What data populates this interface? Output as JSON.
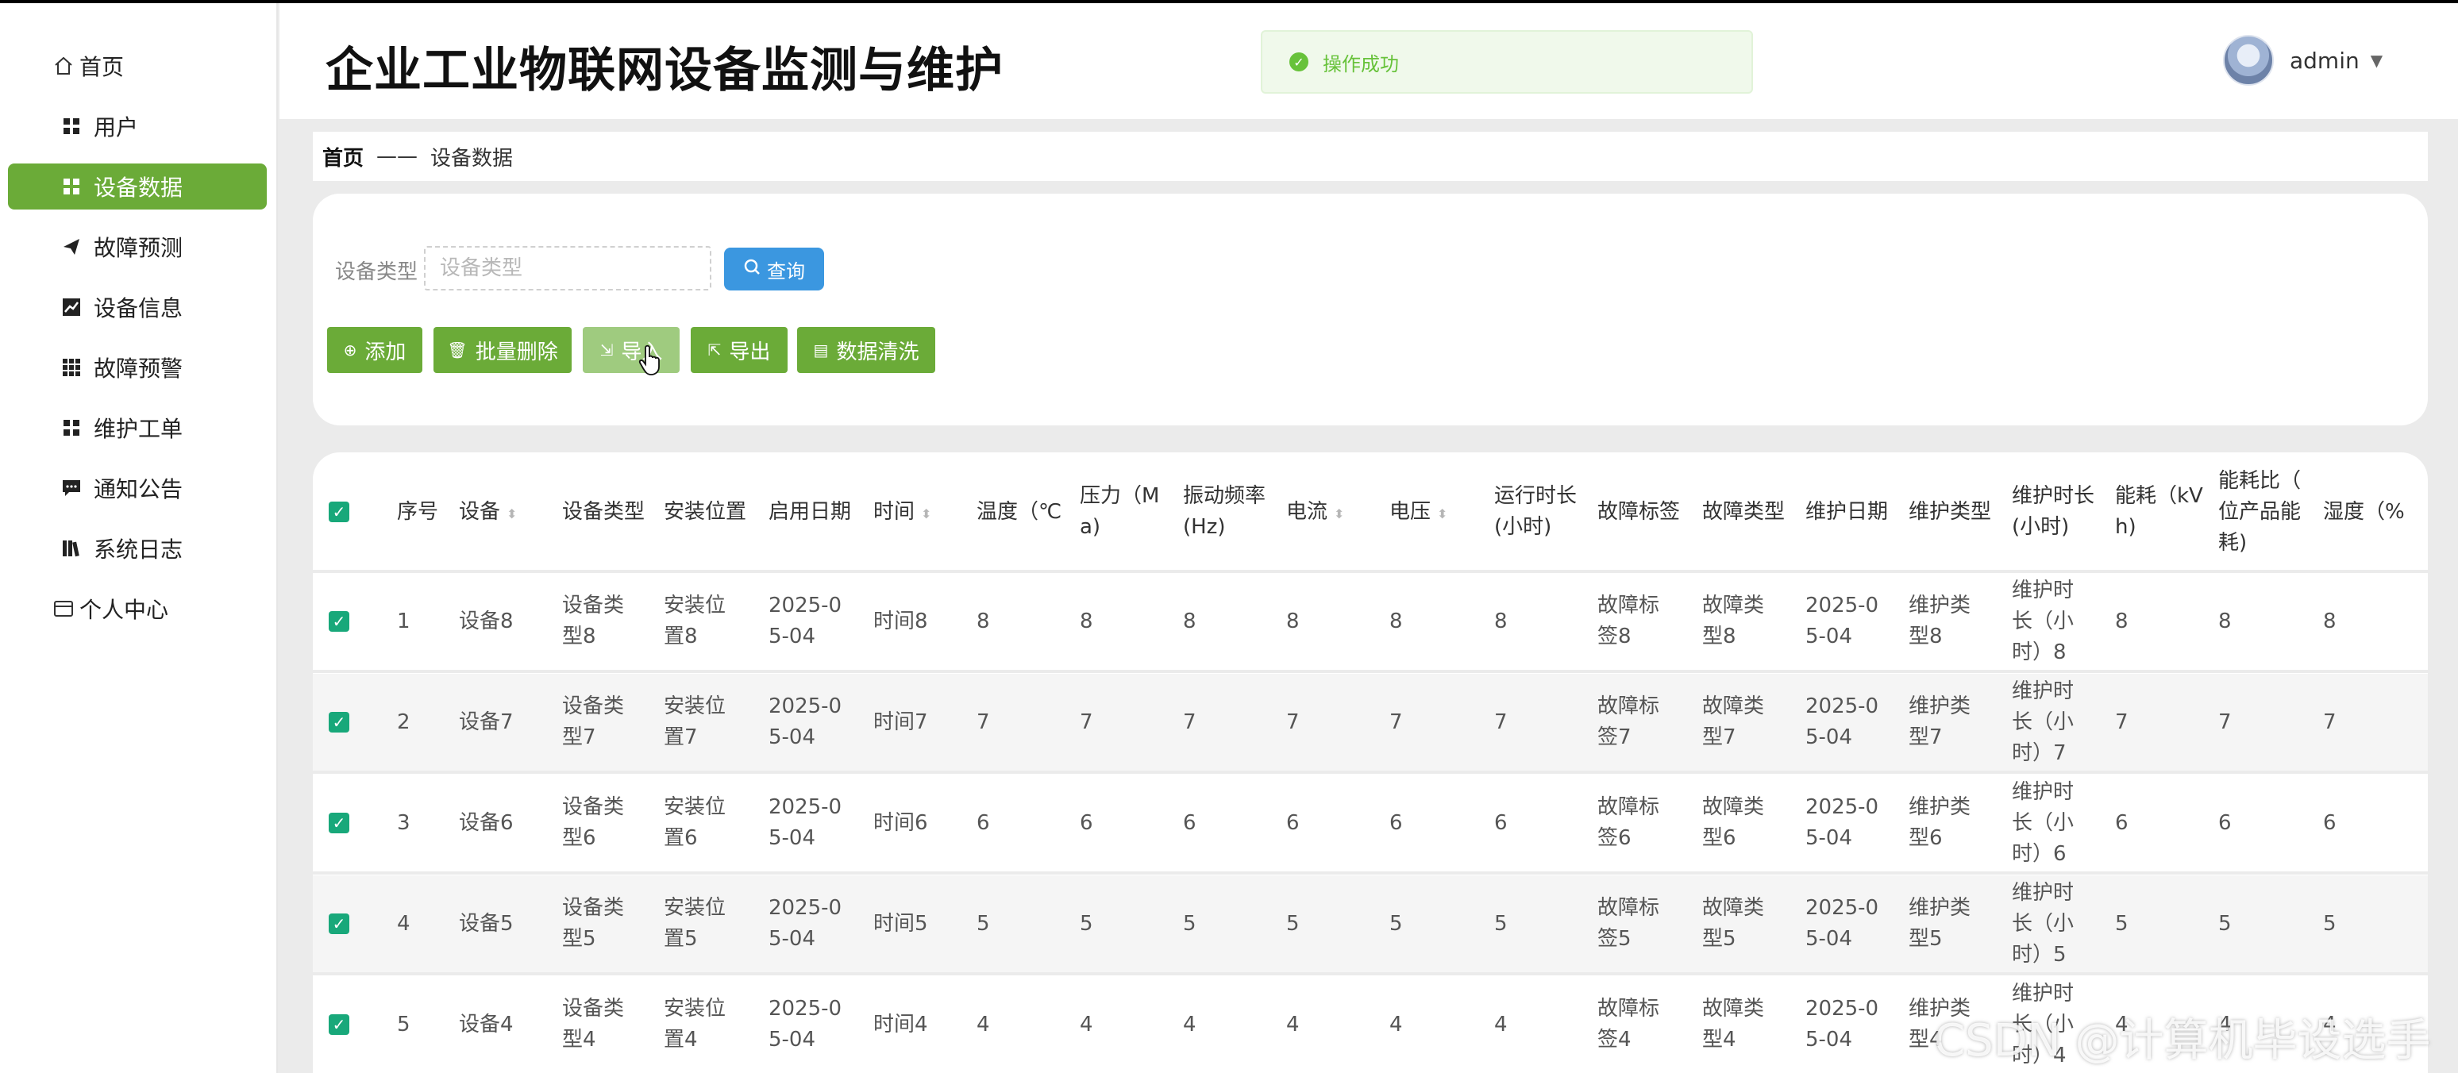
{
  "app": {
    "title": "企业工业物联网设备监测与维护"
  },
  "toast": {
    "message": "操作成功"
  },
  "user": {
    "name": "admin"
  },
  "sidebar": {
    "items": [
      {
        "label": "首页"
      },
      {
        "label": "用户"
      },
      {
        "label": "设备数据"
      },
      {
        "label": "故障预测"
      },
      {
        "label": "设备信息"
      },
      {
        "label": "故障预警"
      },
      {
        "label": "维护工单"
      },
      {
        "label": "通知公告"
      },
      {
        "label": "系统日志"
      },
      {
        "label": "个人中心"
      }
    ]
  },
  "breadcrumb": {
    "home": "首页",
    "separator": "——",
    "current": "设备数据"
  },
  "search": {
    "label": "设备类型",
    "placeholder": "设备类型",
    "value": "",
    "button": "查询"
  },
  "actions": {
    "add": "添加",
    "batch_delete": "批量删除",
    "import": "导入",
    "export": "导出",
    "clean": "数据清洗"
  },
  "table": {
    "headers": {
      "index": "序号",
      "device": "设备",
      "device_type": "设备类型",
      "location": "安装位置",
      "start_date": "启用日期",
      "time": "时间",
      "temperature": "温度（℃",
      "pressure": "压力（M|a)",
      "vibration": "振动频率|(Hz)",
      "current": "电流",
      "voltage": "电压",
      "runtime": "运行时长|(小时)",
      "fault_label": "故障标签",
      "fault_type": "故障类型",
      "maint_date": "维护日期",
      "maint_type": "维护类型",
      "maint_duration": "维护时长|(小时)",
      "energy": "能耗（kV|h)",
      "energy_ratio": "能耗比（|位产品能|耗)",
      "humidity": "湿度（%"
    },
    "rows": [
      {
        "index": "1",
        "device": "设备8",
        "device_type": "设备类|型8",
        "location": "安装位|置8",
        "start_date": "2025-0|5-04",
        "time": "时间8",
        "temperature": "8",
        "pressure": "8",
        "vibration": "8",
        "current": "8",
        "voltage": "8",
        "runtime": "8",
        "fault_label": "故障标|签8",
        "fault_type": "故障类|型8",
        "maint_date": "2025-0|5-04",
        "maint_type": "维护类|型8",
        "maint_duration": "维护时|长（小|时）8",
        "energy": "8",
        "energy_ratio": "8",
        "humidity": "8"
      },
      {
        "index": "2",
        "device": "设备7",
        "device_type": "设备类|型7",
        "location": "安装位|置7",
        "start_date": "2025-0|5-04",
        "time": "时间7",
        "temperature": "7",
        "pressure": "7",
        "vibration": "7",
        "current": "7",
        "voltage": "7",
        "runtime": "7",
        "fault_label": "故障标|签7",
        "fault_type": "故障类|型7",
        "maint_date": "2025-0|5-04",
        "maint_type": "维护类|型7",
        "maint_duration": "维护时|长（小|时）7",
        "energy": "7",
        "energy_ratio": "7",
        "humidity": "7"
      },
      {
        "index": "3",
        "device": "设备6",
        "device_type": "设备类|型6",
        "location": "安装位|置6",
        "start_date": "2025-0|5-04",
        "time": "时间6",
        "temperature": "6",
        "pressure": "6",
        "vibration": "6",
        "current": "6",
        "voltage": "6",
        "runtime": "6",
        "fault_label": "故障标|签6",
        "fault_type": "故障类|型6",
        "maint_date": "2025-0|5-04",
        "maint_type": "维护类|型6",
        "maint_duration": "维护时|长（小|时）6",
        "energy": "6",
        "energy_ratio": "6",
        "humidity": "6"
      },
      {
        "index": "4",
        "device": "设备5",
        "device_type": "设备类|型5",
        "location": "安装位|置5",
        "start_date": "2025-0|5-04",
        "time": "时间5",
        "temperature": "5",
        "pressure": "5",
        "vibration": "5",
        "current": "5",
        "voltage": "5",
        "runtime": "5",
        "fault_label": "故障标|签5",
        "fault_type": "故障类|型5",
        "maint_date": "2025-0|5-04",
        "maint_type": "维护类|型5",
        "maint_duration": "维护时|长（小|时）5",
        "energy": "5",
        "energy_ratio": "5",
        "humidity": "5"
      },
      {
        "index": "5",
        "device": "设备4",
        "device_type": "设备类|型4",
        "location": "安装位|置4",
        "start_date": "2025-0|5-04",
        "time": "时间4",
        "temperature": "4",
        "pressure": "4",
        "vibration": "4",
        "current": "4",
        "voltage": "4",
        "runtime": "4",
        "fault_label": "故障标|签4",
        "fault_type": "故障类|型4",
        "maint_date": "2025-0|5-04",
        "maint_type": "维护类|型4",
        "maint_duration": "维护时|长（小|时）4",
        "energy": "4",
        "energy_ratio": "4",
        "humidity": "4"
      }
    ]
  },
  "watermark": "CSDN @计算机毕设选手",
  "colors": {
    "accent": "#6bab38",
    "query": "#3b97e0",
    "checkbox": "#18a87a",
    "toast_text": "#67c23a"
  }
}
